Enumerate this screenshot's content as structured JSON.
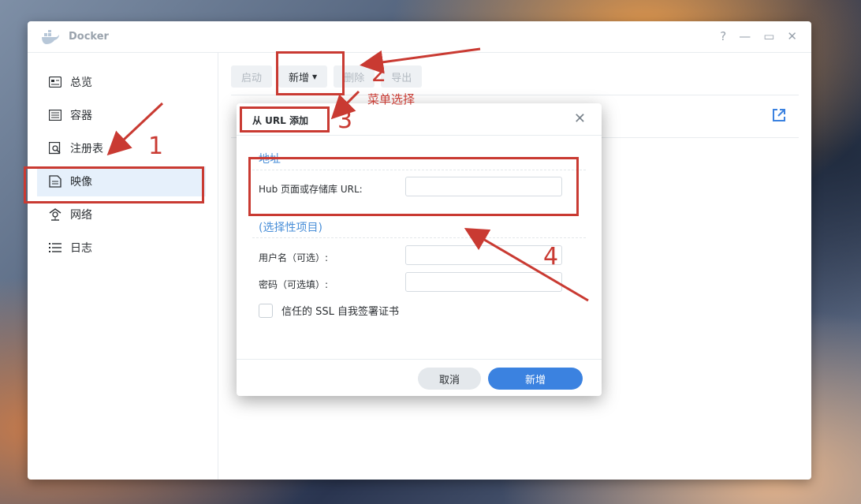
{
  "window": {
    "title": "Docker",
    "controls": [
      "?",
      "—",
      "▭",
      "✕"
    ]
  },
  "sidebar": {
    "items": [
      {
        "label": "总览",
        "icon": "overview-icon"
      },
      {
        "label": "容器",
        "icon": "container-icon"
      },
      {
        "label": "注册表",
        "icon": "registry-icon"
      },
      {
        "label": "映像",
        "icon": "image-icon",
        "active": true
      },
      {
        "label": "网络",
        "icon": "network-icon"
      },
      {
        "label": "日志",
        "icon": "log-icon"
      }
    ]
  },
  "toolbar": {
    "start": "启动",
    "add": "新增",
    "delete": "删除",
    "export": "导出"
  },
  "dialog": {
    "title": "从 URL 添加",
    "section_address": "地址",
    "hub_label": "Hub 页面或存储库 URL:",
    "hub_value": "",
    "section_optional": "(选择性项目)",
    "username_label": "用户名（可选）:",
    "username_value": "",
    "password_label": "密码（可选填）:",
    "password_value": "",
    "ssl_label": "信任的 SSL 自我签署证书",
    "ssl_checked": false,
    "cancel": "取消",
    "confirm": "新增"
  },
  "annotations": {
    "n1": "1",
    "n2": "2",
    "n3": "3",
    "n4": "4",
    "menu_note": "菜单选择",
    "color": "#c93a32"
  },
  "colors": {
    "accent": "#3b82e0",
    "active_bg": "#e6f0fb",
    "annotation": "#c93a32"
  }
}
